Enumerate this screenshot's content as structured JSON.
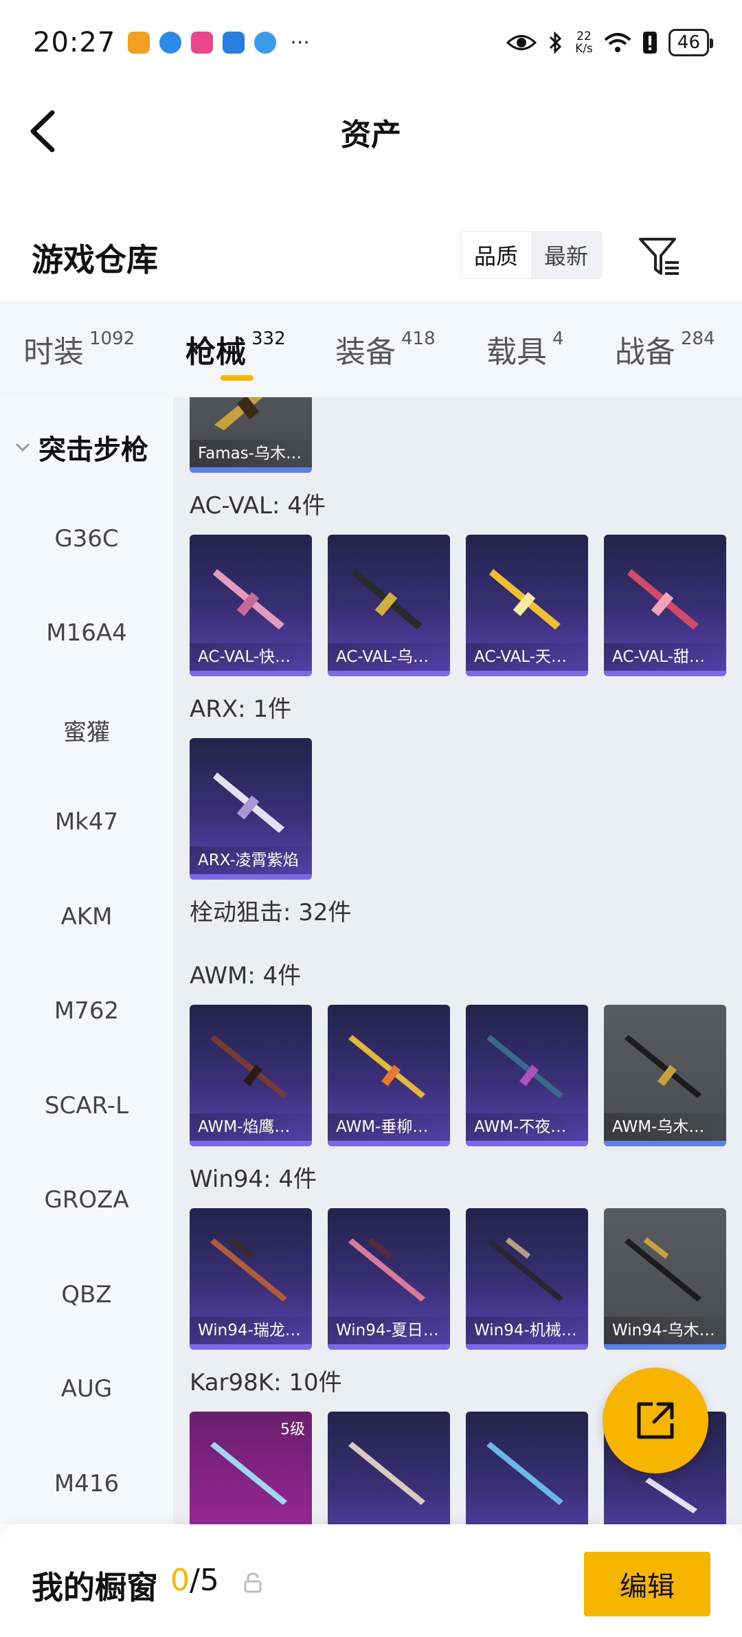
{
  "status_bar": {
    "time": "20:27",
    "net_speed_value": "22",
    "net_speed_unit": "K/s",
    "battery": "46",
    "more": "···"
  },
  "nav": {
    "title": "资产"
  },
  "warehouse": {
    "title": "游戏仓库",
    "sort_options": [
      "品质",
      "最新"
    ],
    "active_sort": "品质"
  },
  "tabs": [
    {
      "label": "时装",
      "count": "1092"
    },
    {
      "label": "枪械",
      "count": "332"
    },
    {
      "label": "装备",
      "count": "418"
    },
    {
      "label": "载具",
      "count": "4"
    },
    {
      "label": "战备",
      "count": "284"
    }
  ],
  "active_tab": "枪械",
  "sidebar": {
    "group": "突击步枪",
    "items": [
      "G36C",
      "M16A4",
      "蜜獾",
      "Mk47",
      "AKM",
      "M762",
      "SCAR-L",
      "GROZA",
      "QBZ",
      "AUG",
      "M416"
    ]
  },
  "main": {
    "partial_card": "Famas-乌木…",
    "groups": [
      {
        "label": "AC-VAL: 4件",
        "items": [
          "AC-VAL-快…",
          "AC-VAL-乌…",
          "AC-VAL-天…",
          "AC-VAL-甜…"
        ]
      },
      {
        "label": "ARX: 1件",
        "items": [
          "ARX-凌霄紫焰"
        ]
      },
      {
        "label": "栓动狙击: 32件"
      },
      {
        "label": "AWM: 4件",
        "items": [
          "AWM-焰鹰…",
          "AWM-垂柳…",
          "AWM-不夜…",
          "AWM-乌木…"
        ]
      },
      {
        "label": "Win94: 4件",
        "items": [
          "Win94-瑞龙…",
          "Win94-夏日…",
          "Win94-机械…",
          "Win94-乌木…"
        ]
      },
      {
        "label": "Kar98K: 10件",
        "level_tag": "5级"
      }
    ]
  },
  "bottom": {
    "showcase_title": "我的橱窗",
    "showcase_current": "0",
    "showcase_total": "/5",
    "edit_label": "编辑"
  },
  "colors": {
    "accent": "#f7b500",
    "card_purple": "#3a2f77",
    "card_grey": "#4f5057",
    "card_pink": "#a0299c"
  }
}
